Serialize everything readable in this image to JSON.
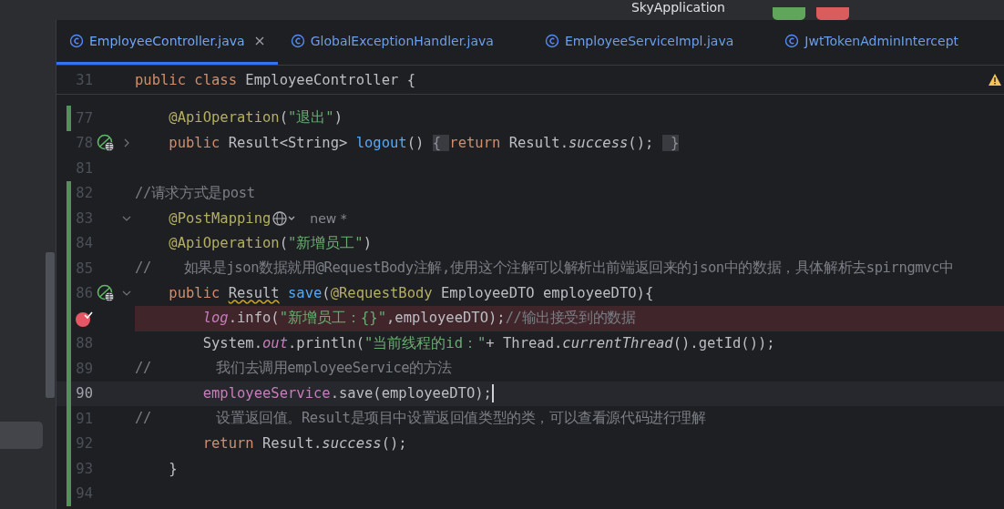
{
  "toolbar": {
    "run_config": "SkyApplication"
  },
  "tabs": [
    {
      "label": "EmployeeController.java",
      "selected": true
    },
    {
      "label": "GlobalExceptionHandler.java",
      "selected": false
    },
    {
      "label": "EmployeeServiceImpl.java",
      "selected": false
    },
    {
      "label": "JwtTokenAdminIntercept",
      "selected": false
    }
  ],
  "sticky_line": {
    "number": "31",
    "tokens": [
      {
        "kind": "keyword",
        "text": "public class "
      },
      {
        "kind": "plain",
        "text": "EmployeeController {"
      }
    ]
  },
  "lines": [
    {
      "number": "77",
      "changed": true,
      "current": false,
      "breakpoint": false,
      "endpoint": false,
      "foldable": false,
      "tokens": [
        {
          "kind": "annotation",
          "text": "    @ApiOperation"
        },
        {
          "kind": "plain",
          "text": "("
        },
        {
          "kind": "string",
          "text": "\"退出\""
        },
        {
          "kind": "plain",
          "text": ")"
        }
      ]
    },
    {
      "number": "78",
      "changed": false,
      "current": false,
      "breakpoint": false,
      "endpoint": true,
      "foldable": true,
      "collapsed": true,
      "tokens": [
        {
          "kind": "keyword",
          "text": "    public "
        },
        {
          "kind": "plain",
          "text": "Result<String> "
        },
        {
          "kind": "method",
          "text": "logout"
        },
        {
          "kind": "plain",
          "text": "() "
        },
        {
          "kind": "folded",
          "text": "{ "
        },
        {
          "kind": "keyword",
          "text": "return "
        },
        {
          "kind": "plain",
          "text": "Result."
        },
        {
          "kind": "static",
          "text": "success"
        },
        {
          "kind": "plain",
          "text": "(); "
        },
        {
          "kind": "folded",
          "text": " }"
        }
      ]
    },
    {
      "number": "81",
      "changed": false,
      "current": false,
      "breakpoint": false,
      "endpoint": false,
      "foldable": false
    },
    {
      "number": "82",
      "changed": true,
      "current": false,
      "breakpoint": false,
      "endpoint": false,
      "foldable": false,
      "tokens": [
        {
          "kind": "comment",
          "text": "//请求方式是post"
        }
      ]
    },
    {
      "number": "83",
      "changed": true,
      "current": false,
      "breakpoint": false,
      "endpoint": false,
      "foldable": true,
      "collapsed": false,
      "web_icon": true,
      "hint": "new *",
      "tokens": [
        {
          "kind": "annotation",
          "text": "    @PostMapping"
        }
      ]
    },
    {
      "number": "84",
      "changed": true,
      "current": false,
      "breakpoint": false,
      "endpoint": false,
      "foldable": false,
      "tokens": [
        {
          "kind": "annotation",
          "text": "    @ApiOperation"
        },
        {
          "kind": "plain",
          "text": "("
        },
        {
          "kind": "string",
          "text": "\"新增员工\""
        },
        {
          "kind": "plain",
          "text": ")"
        }
      ]
    },
    {
      "number": "85",
      "changed": true,
      "current": false,
      "breakpoint": false,
      "endpoint": false,
      "foldable": false,
      "tokens": [
        {
          "kind": "comment",
          "text": "//    如果是json数据就用@RequestBody注解,使用这个注解可以解析出前端返回来的json中的数据，具体解析去spirngmvc中"
        }
      ]
    },
    {
      "number": "86",
      "changed": true,
      "current": false,
      "breakpoint": false,
      "endpoint": true,
      "foldable": true,
      "collapsed": false,
      "tokens": [
        {
          "kind": "keyword",
          "text": "    public "
        },
        {
          "kind": "warning",
          "text": "Result"
        },
        {
          "kind": "method",
          "text": " save"
        },
        {
          "kind": "plain",
          "text": "("
        },
        {
          "kind": "annotation",
          "text": "@RequestBody"
        },
        {
          "kind": "plain",
          "text": " EmployeeDTO employeeDTO){"
        }
      ]
    },
    {
      "changed": true,
      "current": false,
      "breakpoint": true,
      "endpoint": false,
      "foldable": false,
      "tokens": [
        {
          "kind": "field",
          "text": "        log"
        },
        {
          "kind": "plain",
          "text": ".info("
        },
        {
          "kind": "string",
          "text": "\"新增员工：{}\""
        },
        {
          "kind": "plain",
          "text": ",employeeDTO);"
        },
        {
          "kind": "comment",
          "text": "//输出接受到的数据"
        }
      ]
    },
    {
      "number": "88",
      "changed": true,
      "current": false,
      "breakpoint": false,
      "endpoint": false,
      "foldable": false,
      "tokens": [
        {
          "kind": "plain",
          "text": "        System."
        },
        {
          "kind": "field",
          "text": "out"
        },
        {
          "kind": "plain",
          "text": ".println("
        },
        {
          "kind": "string",
          "text": "\"当前线程的id：\""
        },
        {
          "kind": "plain",
          "text": "+ Thread."
        },
        {
          "kind": "static",
          "text": "currentThread"
        },
        {
          "kind": "plain",
          "text": "().getId());"
        }
      ]
    },
    {
      "number": "89",
      "changed": true,
      "current": false,
      "breakpoint": false,
      "endpoint": false,
      "foldable": false,
      "tokens": [
        {
          "kind": "comment",
          "text": "//        我们去调用employeeService的方法"
        }
      ]
    },
    {
      "number": "90",
      "changed": true,
      "current": true,
      "breakpoint": false,
      "endpoint": false,
      "foldable": false,
      "tokens": [
        {
          "kind": "member",
          "text": "        employeeService"
        },
        {
          "kind": "plain",
          "text": ".save(employeeDTO);"
        }
      ]
    },
    {
      "number": "91",
      "changed": true,
      "current": false,
      "breakpoint": false,
      "endpoint": false,
      "foldable": false,
      "tokens": [
        {
          "kind": "comment",
          "text": "//        设置返回值。Result是项目中设置返回值类型的类，可以查看源代码进行理解"
        }
      ]
    },
    {
      "number": "92",
      "changed": true,
      "current": false,
      "breakpoint": false,
      "endpoint": false,
      "foldable": false,
      "tokens": [
        {
          "kind": "keyword",
          "text": "        return "
        },
        {
          "kind": "plain",
          "text": "Result."
        },
        {
          "kind": "static",
          "text": "success"
        },
        {
          "kind": "plain",
          "text": "();"
        }
      ]
    },
    {
      "number": "93",
      "changed": true,
      "current": false,
      "breakpoint": false,
      "endpoint": false,
      "foldable": false,
      "tokens": [
        {
          "kind": "plain",
          "text": "    }"
        }
      ]
    },
    {
      "number": "94",
      "changed": true,
      "current": false,
      "breakpoint": false,
      "endpoint": false,
      "foldable": false
    }
  ]
}
